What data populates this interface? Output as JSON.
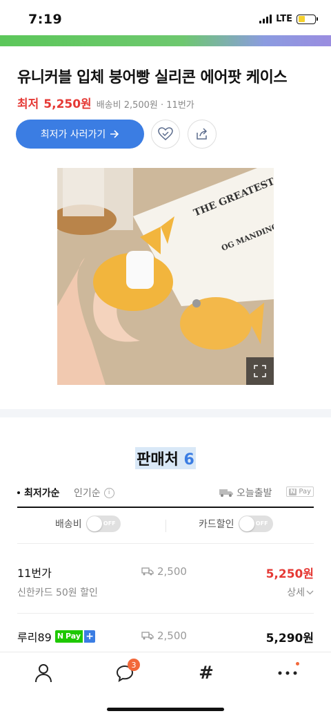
{
  "status_bar": {
    "time": "7:19",
    "network": "LTE"
  },
  "product": {
    "title": "유니커블 입체 붕어빵 실리콘 에어팟 케이스",
    "price_label": "최저",
    "price": "5,250원",
    "meta": "배송비 2,500원 · 11번가",
    "buy_button": "최저가 사러가기",
    "image_text": [
      "THE GREATEST SALESMAN IN THE WORLD",
      "OG MANDINO"
    ]
  },
  "sellers": {
    "heading": "판매처",
    "count": "6",
    "sort_active": "최저가순",
    "sort_popular": "인기순",
    "today_ship": "오늘출발",
    "npay_chip_n": "N",
    "npay_chip_text": "Pay",
    "filter_shipping": "배송비",
    "filter_card": "카드할인",
    "toggle_off": "OFF",
    "rows": [
      {
        "name": "11번가",
        "shipping": "2,500",
        "price": "5,250원",
        "sub": "신한카드 50원 할인",
        "detail": "상세"
      },
      {
        "name": "루리89",
        "shipping": "2,500",
        "price": "5,290원",
        "npay": "Pay"
      }
    ]
  },
  "tabbar": {
    "chat_badge": "3"
  },
  "colors": {
    "accent": "#3b7de3",
    "price_red": "#e53935",
    "npay_green": "#1ec800"
  }
}
